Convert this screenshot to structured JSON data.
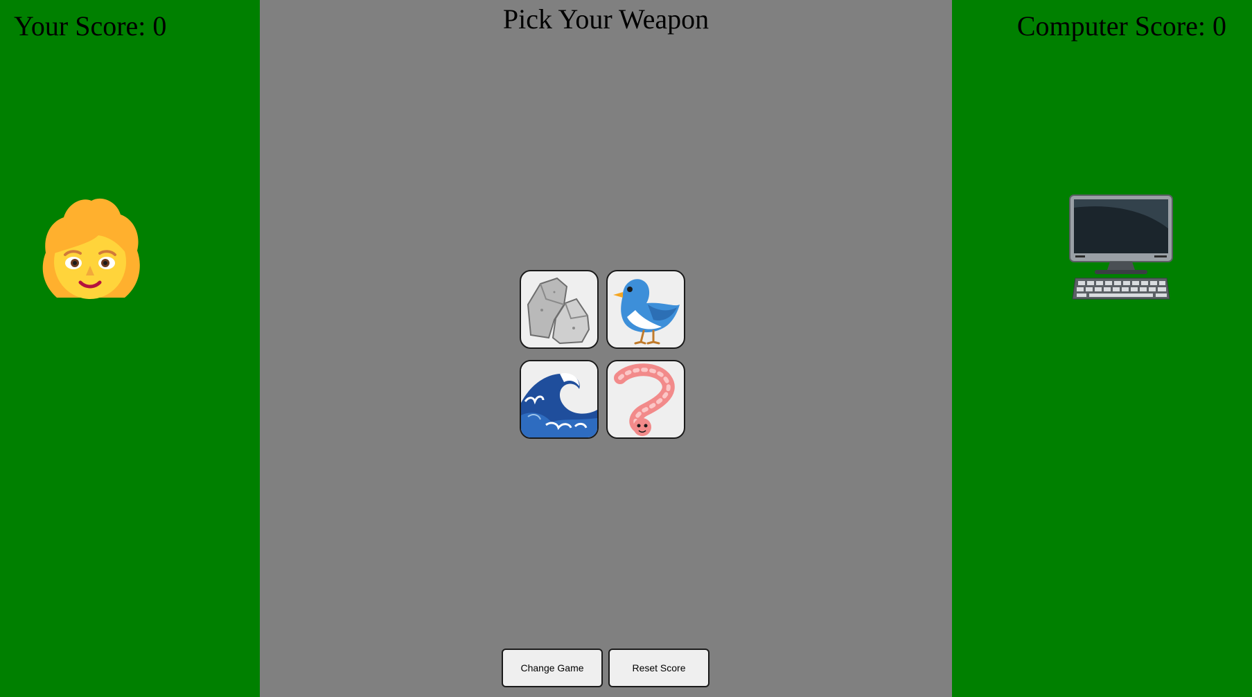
{
  "player": {
    "score_label": "Your Score: 0",
    "avatar_icon": "woman-face-icon"
  },
  "computer": {
    "score_label": "Computer Score: 0",
    "avatar_icon": "desktop-computer-icon"
  },
  "center": {
    "title": "Pick Your Weapon"
  },
  "weapons": [
    {
      "name": "rock",
      "icon": "rock-icon"
    },
    {
      "name": "bird",
      "icon": "bird-icon"
    },
    {
      "name": "wave",
      "icon": "water-wave-icon"
    },
    {
      "name": "worm",
      "icon": "worm-icon"
    }
  ],
  "buttons": {
    "change_game": "Change Game",
    "reset_score": "Reset Score"
  },
  "colors": {
    "side_panel": "#008000",
    "center_panel": "#808080",
    "card_bg": "#efefef"
  }
}
